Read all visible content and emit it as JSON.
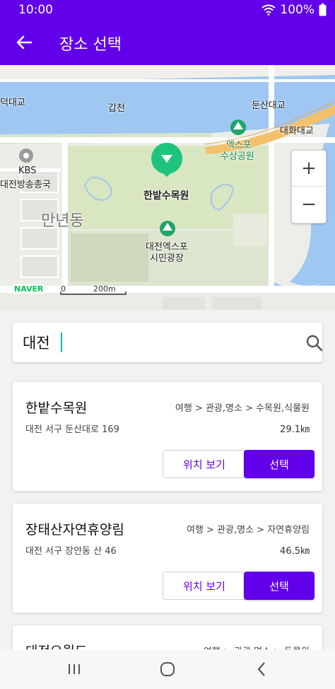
{
  "status_bar": {
    "time": "10:00",
    "battery": "100%"
  },
  "app_bar": {
    "title": "장소 선택",
    "back_icon": "arrow-left-icon"
  },
  "map": {
    "labels": {
      "gapcheon": "갑천",
      "dunsan_bridge": "둔산대교",
      "left_bridge": "덕대교",
      "daehwa_bridge": "대화대교",
      "expo_park_1": "엑스포",
      "expo_park_2": "수상공원",
      "kbs_1": "KBS",
      "kbs_2": "대전방송총국",
      "marker_place": "한밭수목원",
      "district": "만년동",
      "expo_square_1": "대전엑스포",
      "expo_square_2": "시민광장"
    },
    "zoom_in": "+",
    "zoom_out": "−",
    "logo": "NAVER",
    "scale_zero": "0",
    "scale_value": "200m"
  },
  "search": {
    "value": "대전",
    "icon": "search-icon"
  },
  "results": [
    {
      "name": "한밭수목원",
      "category": "여행 > 관광,명소 > 수목원,식물원",
      "address": "대전 서구 둔산대로 169",
      "distance": "29.1㎞",
      "view_label": "위치 보기",
      "select_label": "선택"
    },
    {
      "name": "장태산자연휴양림",
      "category": "여행 > 관광,명소 > 자연휴양림",
      "address": "대전 서구 장안동 산 46",
      "distance": "46.5㎞",
      "view_label": "위치 보기",
      "select_label": "선택"
    },
    {
      "name": "대전오월드",
      "category": "여행 > 관광,명소 > 동물원",
      "address": "",
      "distance": "",
      "view_label": "",
      "select_label": ""
    }
  ],
  "colors": {
    "primary": "#6200ea",
    "marker": "#1ec47e",
    "water": "#9fc7f2",
    "park": "#d9e6c3"
  }
}
